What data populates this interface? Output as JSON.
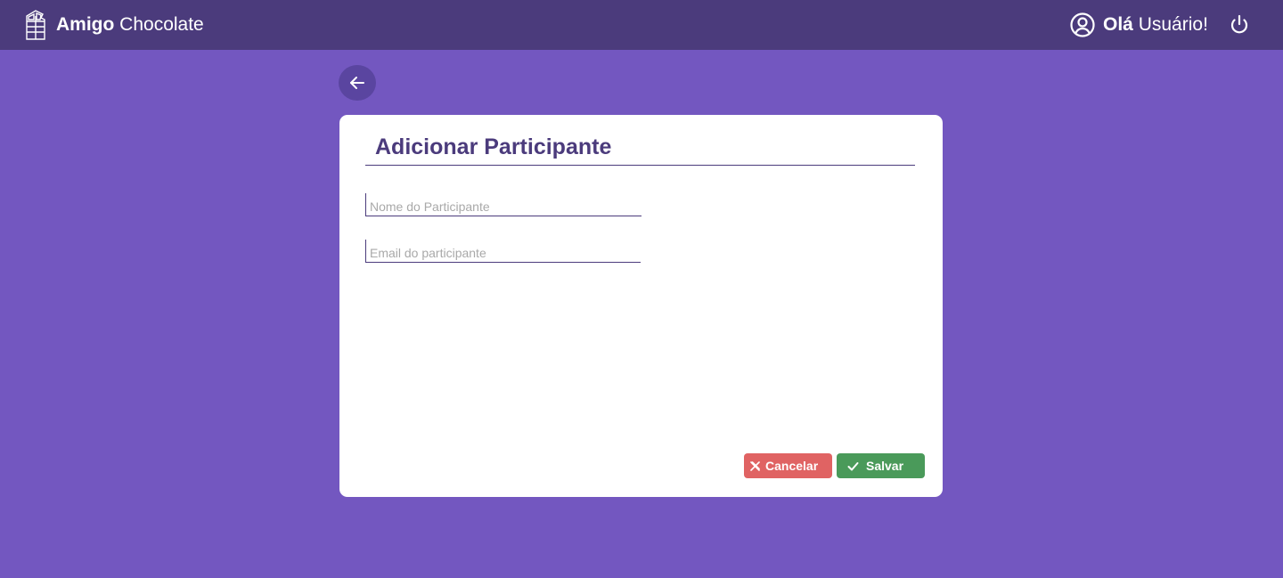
{
  "header": {
    "brand_bold": "Amigo",
    "brand_light": "Chocolate",
    "greeting_bold": "Olá",
    "greeting_light": "Usuário!",
    "icons": {
      "logo": "chocolate-bar-icon",
      "user": "user-circle-icon",
      "logout": "power-icon"
    }
  },
  "navigation": {
    "back_icon": "arrow-left-icon"
  },
  "form": {
    "title": "Adicionar Participante",
    "name_field": {
      "value": "",
      "placeholder": "Nome do Participante"
    },
    "email_field": {
      "value": "",
      "placeholder": "Email do participante"
    },
    "cancel_label": "Cancelar",
    "save_label": "Salvar"
  },
  "colors": {
    "background": "#7357c0",
    "topbar": "#4b3b7c",
    "title": "#4b3b7c",
    "cancel": "#e06363",
    "save": "#4a9a5a"
  }
}
